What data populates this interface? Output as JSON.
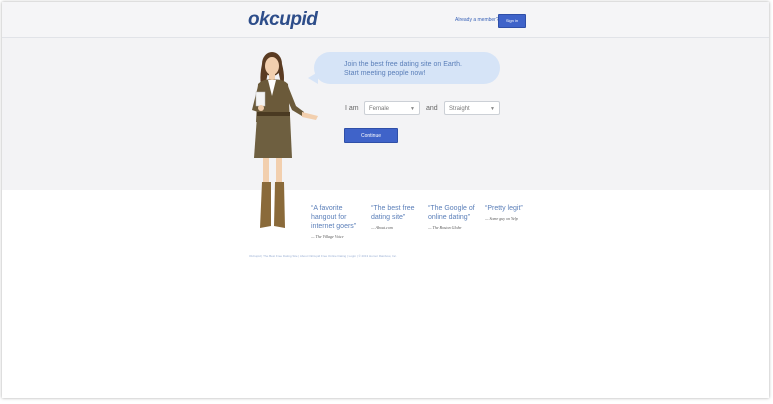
{
  "header": {
    "logo": "okcupid",
    "already_member": "Already a member?",
    "sign_in": "Sign in"
  },
  "signup": {
    "bubble_line1": "Join the best free dating site on Earth.",
    "bubble_line2": "Start meeting people now!",
    "i_am": "I am",
    "gender_value": "Female",
    "and": "and",
    "orientation_value": "Straight",
    "continue_label": "Continue"
  },
  "quotes": [
    {
      "line1": "“A favorite",
      "line2": "hangout for",
      "line3": "internet goers”",
      "source": "— The Village Voice"
    },
    {
      "line1": "“The best free",
      "line2": "dating site”",
      "line3": "",
      "source": "— About.com"
    },
    {
      "line1": "“The Google of",
      "line2": "online dating”",
      "line3": "",
      "source": "— The Boston Globe"
    },
    {
      "line1": "“Pretty legit”",
      "line2": "",
      "line3": "",
      "source": "— Some guy on Yelp"
    }
  ],
  "footer": {
    "text": "OkCupid  |  The Best Free Dating Site  |  About OkCupid Free Online Dating  |  Login  |  © 2013 Humor Rainbow, Inc."
  },
  "colors": {
    "accent": "#3f63c9",
    "bubble": "#d6e4f7",
    "logo": "#2d4d8a"
  }
}
